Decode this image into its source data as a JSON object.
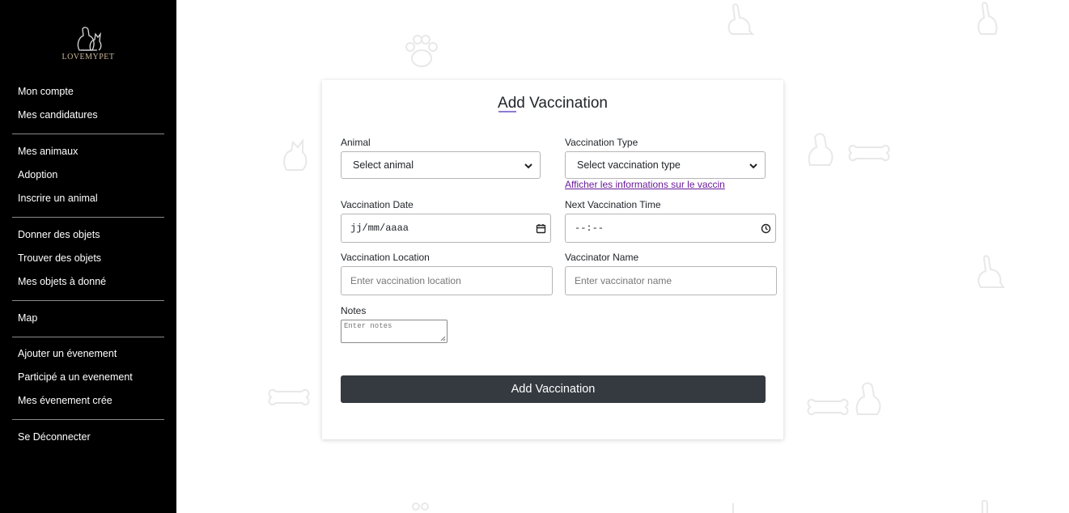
{
  "logo": {
    "text": "LOVEMYPET"
  },
  "nav": {
    "items": [
      "Mon compte",
      "Mes candidatures",
      "Mes animaux",
      "Adoption",
      "Inscrire un animal",
      "Donner des objets",
      "Trouver des objets",
      "Mes objets à donné",
      "Map",
      "Ajouter un évenement",
      "Participé a un evenement",
      "Mes évenement crée",
      "Se Déconnecter"
    ]
  },
  "form": {
    "title": "Add Vaccination",
    "animal": {
      "label": "Animal",
      "value": "Select animal"
    },
    "vaccination_type": {
      "label": "Vaccination Type",
      "value": "Select vaccination type"
    },
    "info_link": "Afficher les informations sur le vaccin",
    "vaccination_date": {
      "label": "Vaccination Date",
      "placeholder": "jj/mm/aaaa"
    },
    "next_time": {
      "label": "Next Vaccination Time",
      "placeholder": "--:--"
    },
    "location": {
      "label": "Vaccination Location",
      "placeholder": "Enter vaccination location"
    },
    "vaccinator": {
      "label": "Vaccinator Name",
      "placeholder": "Enter vaccinator name"
    },
    "notes": {
      "label": "Notes",
      "placeholder": "Enter notes"
    },
    "submit_label": "Add Vaccination"
  },
  "colors": {
    "sidebar_bg": "#000000",
    "button_bg": "#343a40",
    "link": "#6a1b9a",
    "decoration": "#ececec"
  },
  "decorations": [
    "paw-icon",
    "rabbit-icon",
    "dog-icon",
    "cat-icon",
    "bone-icon"
  ]
}
